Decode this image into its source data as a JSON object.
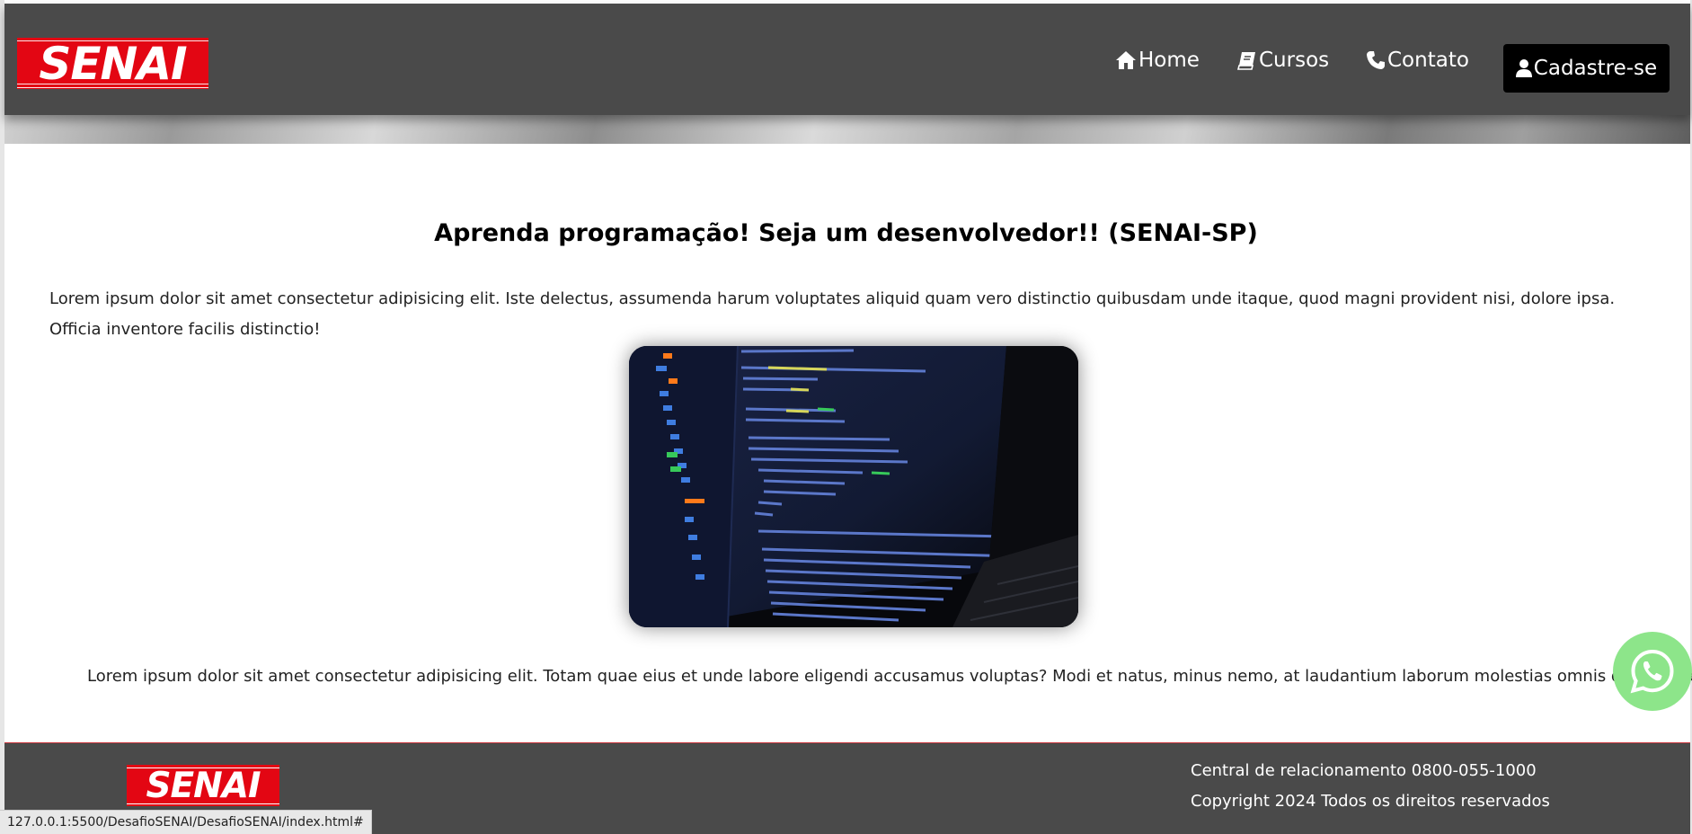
{
  "header": {
    "logo_text": "SENAI",
    "nav": {
      "home": "Home",
      "cursos": "Cursos",
      "contato": "Contato",
      "cadastre": "Cadastre-se"
    }
  },
  "main": {
    "title": "Aprenda programação! Seja um desenvolvedor!! (SENAI-SP)",
    "intro": "Lorem ipsum dolor sit amet consectetur adipisicing elit. Iste delectus, assumenda harum voluptates aliquid quam vero distinctio quibusdam unde itaque, quod magni provident nisi, dolore ipsa. Officia inventore facilis distinctio!",
    "outro": "Lorem ipsum dolor sit amet consectetur adipisicing elit. Totam quae eius et unde labore eligendi accusamus voluptas? Modi et natus, minus nemo, at laudantium laborum molestias omnis quaerat vel labore."
  },
  "footer": {
    "logo_text": "SENAI",
    "line1": "Central de relacionamento 0800-055-1000",
    "line2": "Copyright 2024 Todos os direitos reservados"
  },
  "status_bar": {
    "url": "127.0.0.1:5500/DesafioSENAI/DesafioSENAI/index.html#"
  },
  "icons": {
    "home": "home-icon",
    "cursos": "book-icon",
    "contato": "phone-icon",
    "cadastre": "user-icon",
    "whatsapp": "whatsapp-icon"
  },
  "colors": {
    "header_bg": "#4a4a4a",
    "brand_red": "#e30613",
    "button_bg": "#000000",
    "whatsapp_green": "#8de58a",
    "footer_border": "#c8343b"
  }
}
